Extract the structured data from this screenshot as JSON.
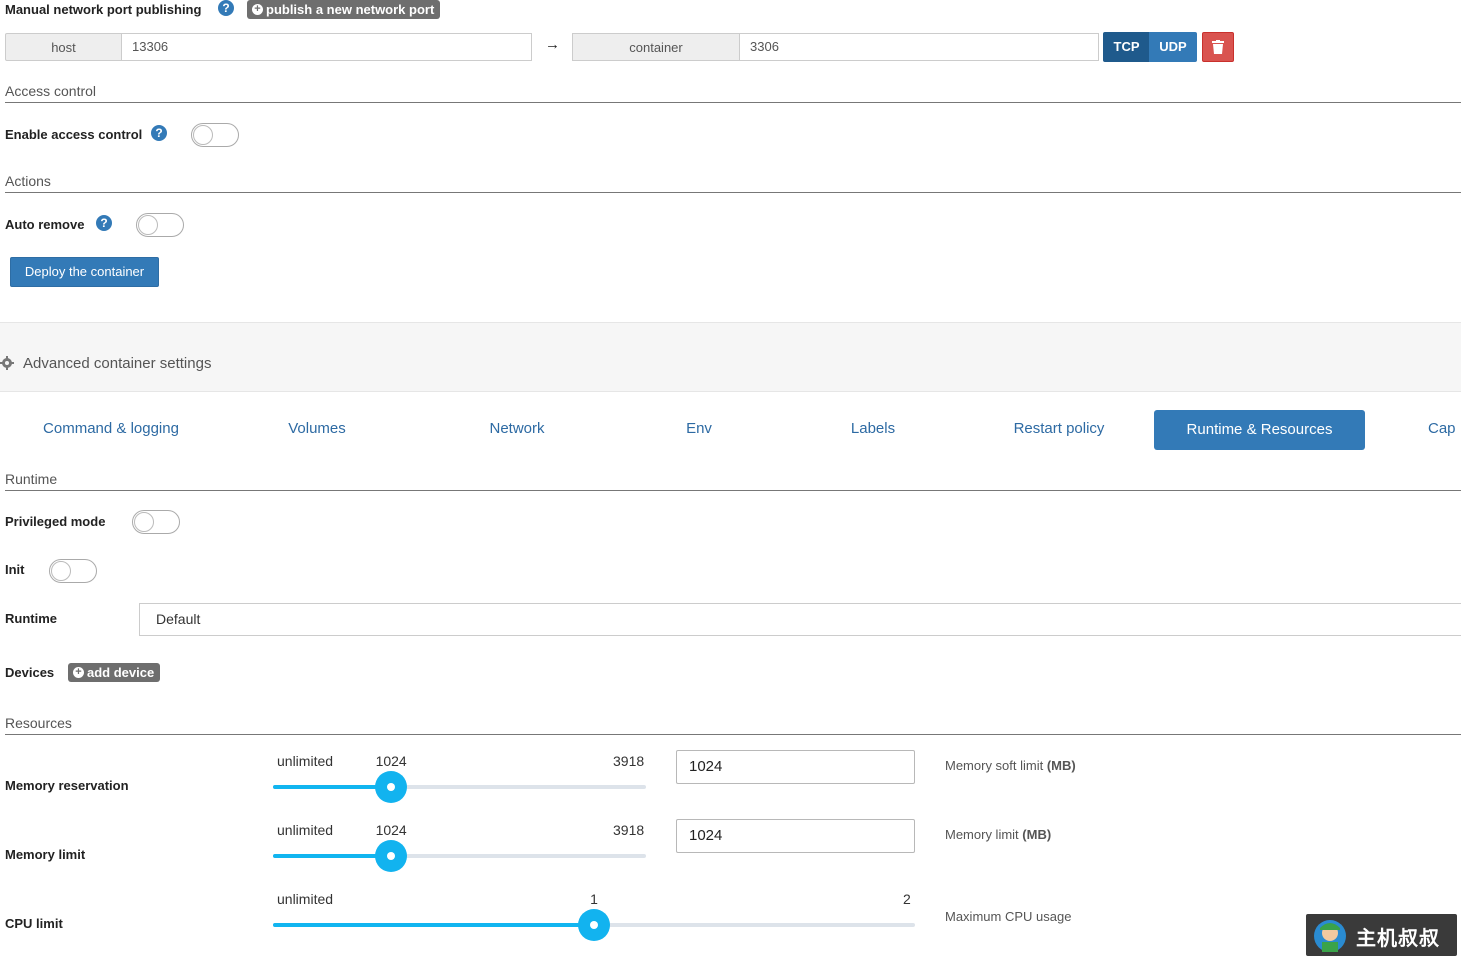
{
  "ports": {
    "title": "Manual network port publishing",
    "publish_label": "publish a new network port",
    "host_addon": "host",
    "host_value": "13306",
    "arrow": "→",
    "container_addon": "container",
    "container_value": "3306",
    "tcp_label": "TCP",
    "udp_label": "UDP"
  },
  "access": {
    "section_title": "Access control",
    "enable_label": "Enable access control",
    "enabled": false
  },
  "actions": {
    "section_title": "Actions",
    "auto_remove_label": "Auto remove",
    "auto_remove": false,
    "deploy_label": "Deploy the container"
  },
  "advanced": {
    "title": "Advanced container settings",
    "tabs": [
      {
        "label": "Command & logging"
      },
      {
        "label": "Volumes"
      },
      {
        "label": "Network"
      },
      {
        "label": "Env"
      },
      {
        "label": "Labels"
      },
      {
        "label": "Restart policy"
      },
      {
        "label": "Runtime & Resources",
        "active": true
      },
      {
        "label": "Cap"
      }
    ]
  },
  "runtime": {
    "section_title": "Runtime",
    "privileged_label": "Privileged mode",
    "privileged": false,
    "init_label": "Init",
    "init": false,
    "runtime_label": "Runtime",
    "runtime_value": "Default",
    "devices_label": "Devices",
    "add_device_label": "add device"
  },
  "resources": {
    "section_title": "Resources",
    "memory_reservation": {
      "label": "Memory reservation",
      "min_label": "unlimited",
      "value_label": "1024",
      "max_label": "3918",
      "value": 1024,
      "max": 3918,
      "input_value": "1024",
      "hint_prefix": "Memory soft limit ",
      "hint_unit": "(MB)"
    },
    "memory_limit": {
      "label": "Memory limit",
      "min_label": "unlimited",
      "value_label": "1024",
      "max_label": "3918",
      "value": 1024,
      "max": 3918,
      "input_value": "1024",
      "hint_prefix": "Memory limit ",
      "hint_unit": "(MB)"
    },
    "cpu_limit": {
      "label": "CPU limit",
      "min_label": "unlimited",
      "value_label": "1",
      "max_label": "2",
      "value": 1,
      "max": 2,
      "hint": "Maximum CPU usage"
    }
  },
  "colors": {
    "primary": "#337ab7",
    "primary_dark": "#286090",
    "danger": "#d9534f",
    "slider": "#11b5f0"
  },
  "watermark": {
    "text": "主机叔叔"
  }
}
